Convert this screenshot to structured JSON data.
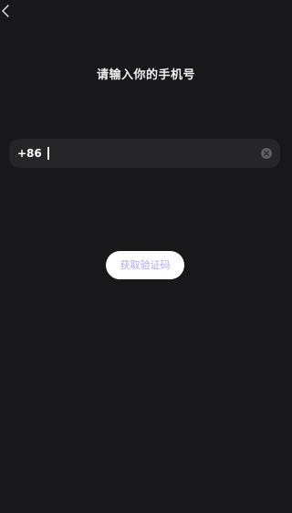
{
  "navigation": {
    "back_icon": "chevron-left-icon"
  },
  "page": {
    "title": "请输入你的手机号"
  },
  "phone_field": {
    "country_code": "+86",
    "value": "",
    "placeholder": "",
    "clear_icon": "clear-circle-icon"
  },
  "actions": {
    "get_code_label": "获取验证码"
  },
  "colors": {
    "background": "#18181a",
    "field_background": "#262629",
    "button_background": "#ffffff",
    "button_text": "#b3a8f0",
    "clear_icon": "#5e5e63"
  }
}
